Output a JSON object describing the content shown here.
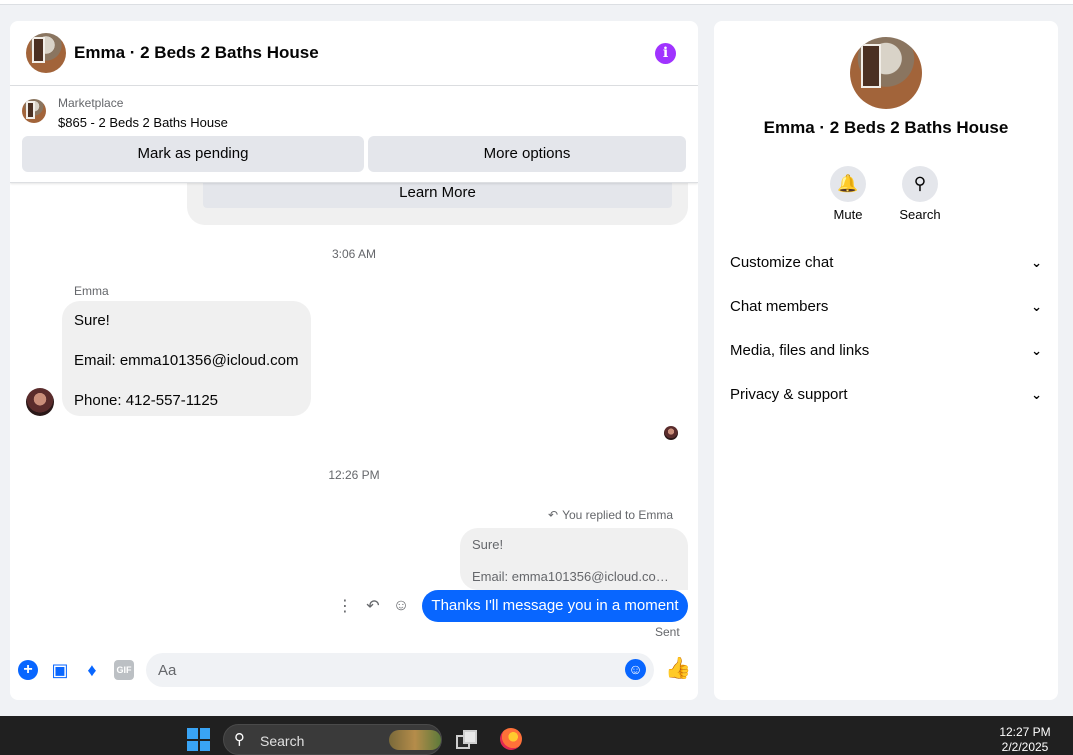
{
  "chat": {
    "title": "Emma · 2 Beds 2 Baths House",
    "marketplace": {
      "label": "Marketplace",
      "listing": "$865 - 2 Beds 2 Baths House",
      "pending_button": "Mark as pending",
      "more_button": "More options"
    },
    "learn_more": "Learn More",
    "timestamp_1": "3:06 AM",
    "sender": "Emma",
    "incoming": {
      "line1": "Sure!",
      "line2": "Email: emma101356@icloud.com",
      "line3": "Phone: 412-557-1125"
    },
    "timestamp_2": "12:26 PM",
    "replied_label": "You replied to Emma",
    "quoted": {
      "line1": "Sure!",
      "line2": "Email: emma101356@icloud.com ..."
    },
    "outgoing": "Thanks I'll message you in a moment",
    "sent_status": "Sent",
    "composer_placeholder": "Aa",
    "gif_label": "GIF"
  },
  "info_panel": {
    "name": "Emma · 2 Beds 2 Baths House",
    "actions": [
      {
        "label": "Mute",
        "icon": "bell-icon"
      },
      {
        "label": "Search",
        "icon": "search-icon"
      }
    ],
    "sections": [
      {
        "label": "Customize chat"
      },
      {
        "label": "Chat members"
      },
      {
        "label": "Media, files and links"
      },
      {
        "label": "Privacy & support"
      }
    ]
  },
  "taskbar": {
    "search_label": "Search",
    "time": "12:27 PM",
    "date": "2/2/2025"
  },
  "colors": {
    "accent": "#0866ff",
    "info": "#a033ff",
    "bubble_in": "#f0f0f0",
    "taskbar": "#202020"
  }
}
